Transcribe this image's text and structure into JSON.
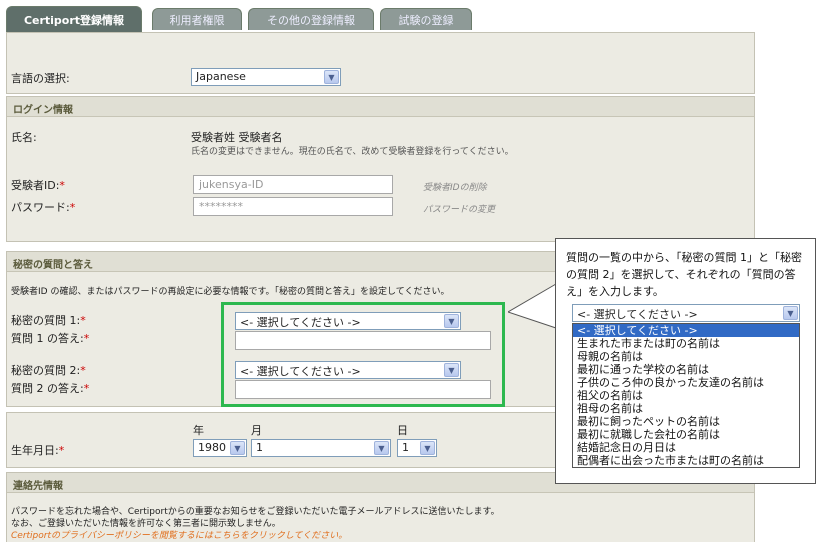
{
  "tabs": [
    {
      "label": "Certiport登録情報",
      "active": true
    },
    {
      "label": "利用者権限",
      "active": false
    },
    {
      "label": "その他の登録情報",
      "active": false
    },
    {
      "label": "試験の登録",
      "active": false
    }
  ],
  "language": {
    "label": "言語の選択:",
    "value": "Japanese"
  },
  "login": {
    "title": "ログイン情報",
    "name_label": "氏名:",
    "name_value": "受験者姓 受験者名",
    "name_note": "氏名の変更はできません。現在の氏名で、改めて受験者登録を行ってください。",
    "id_label": "受験者ID:",
    "id_value": "jukensya-ID",
    "id_link": "受験者IDの削除",
    "pw_label": "パスワード:",
    "pw_value": "********",
    "pw_link": "パスワードの変更",
    "required_mark": "*"
  },
  "secret": {
    "title": "秘密の質問と答え",
    "description": "受験者ID の確認、またはパスワードの再設定に必要な情報です。「秘密の質問と答え」を設定してください。",
    "q1_label": "秘密の質問 1:",
    "a1_label": "質問 1 の答え:",
    "q2_label": "秘密の質問 2:",
    "a2_label": "質問 2 の答え:",
    "select_placeholder": "<- 選択してください ->"
  },
  "birthday": {
    "label": "生年月日:",
    "year_header": "年",
    "month_header": "月",
    "day_header": "日",
    "year": "1980",
    "month": "1",
    "day": "1"
  },
  "contact": {
    "title": "連絡先情報",
    "line1": "パスワードを忘れた場合や、Certiportからの重要なお知らせをご登録いただいた電子メールアドレスに送信いたします。",
    "line2": "なお、ご登録いただいた情報を許可なく第三者に開示致しません。",
    "privacy_link": "Certiportのプライバシーポリシーを閲覧するにはこちらをクリックしてください。"
  },
  "callout": {
    "text": "質問の一覧の中から、「秘密の質問 1」と「秘密の質問 2」を選択して、それぞれの「質問の答え」を入力します。",
    "dropdown_value": "<- 選択してください ->",
    "options": [
      "<- 選択してください ->",
      "生まれた市または町の名前は",
      "母親の名前は",
      "最初に通った学校の名前は",
      "子供のころ仲の良かった友達の名前は",
      "祖父の名前は",
      "祖母の名前は",
      "最初に飼ったペットの名前は",
      "最初に就職した会社の名前は",
      "結婚記念日の月日は",
      "配偶者に出会った市または町の名前は"
    ]
  },
  "colors": {
    "accent_green": "#2db84f",
    "selection_blue": "#316ac5",
    "link_orange": "#e07020",
    "required_red": "#cc0000"
  }
}
